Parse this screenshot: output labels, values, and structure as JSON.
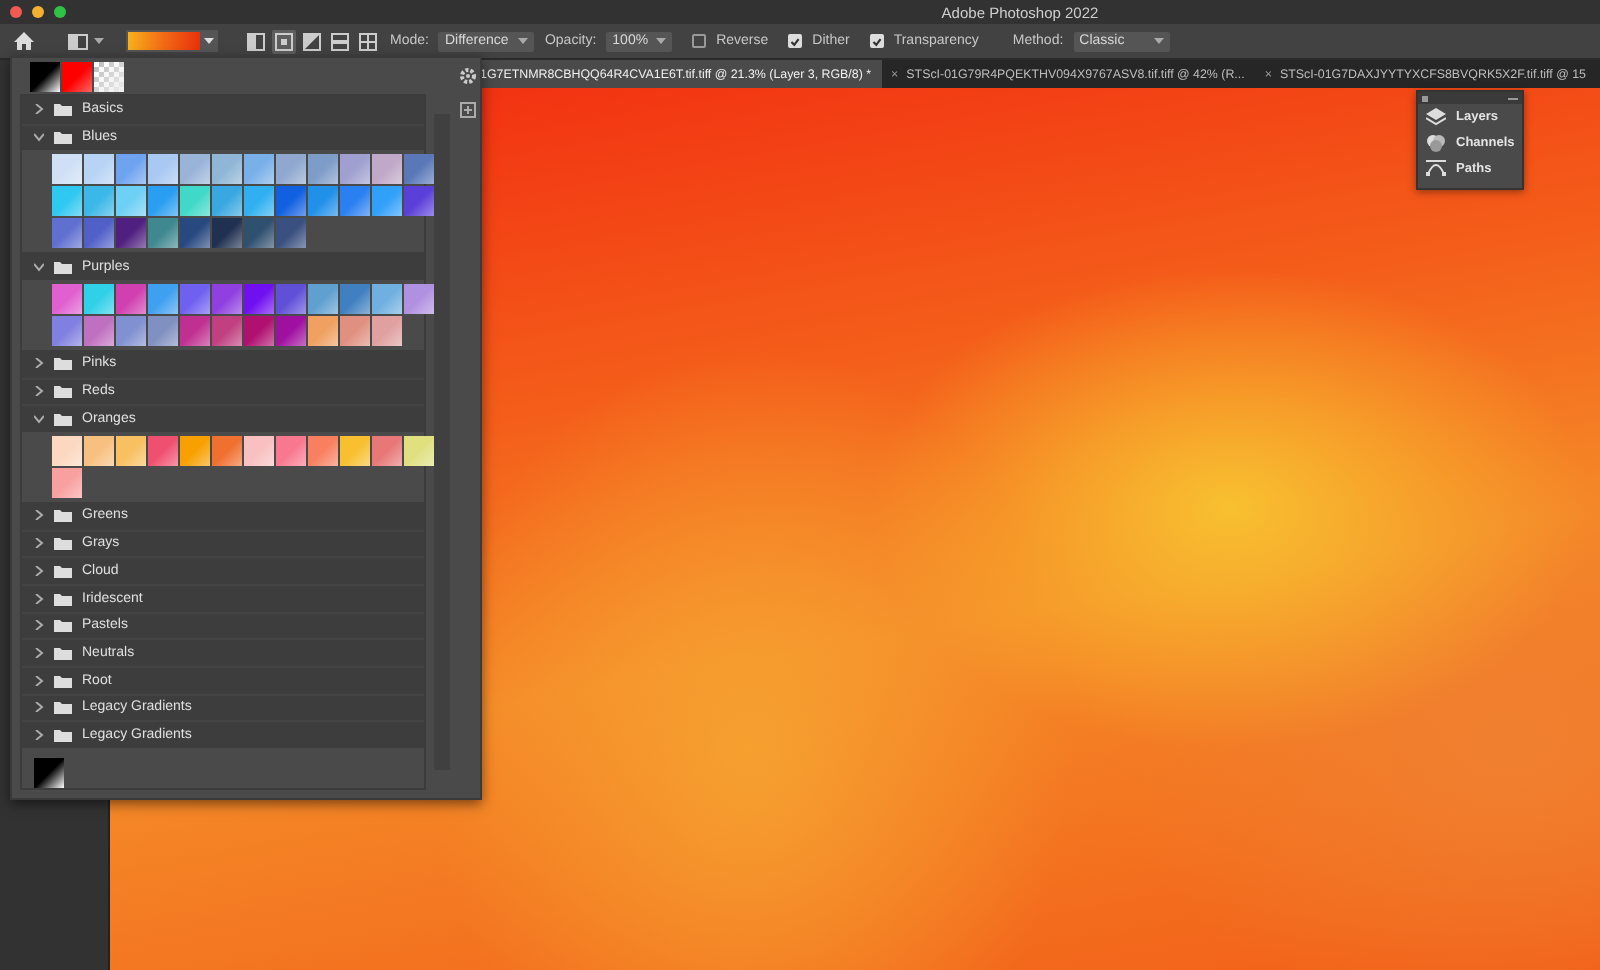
{
  "window": {
    "title": "Adobe Photoshop 2022"
  },
  "options_bar": {
    "gradient_types": [
      {
        "selected": false
      },
      {
        "selected": true
      },
      {
        "selected": false
      },
      {
        "selected": false
      },
      {
        "selected": false
      }
    ],
    "mode_label": "Mode:",
    "mode": "Difference",
    "opacity_label": "Opacity:",
    "opacity": "100%",
    "checkboxes": [
      {
        "label": "Reverse",
        "checked": false
      },
      {
        "label": "Dither",
        "checked": true
      },
      {
        "label": "Transparency",
        "checked": true
      }
    ],
    "method_label": "Method:",
    "method": "Classic"
  },
  "tabs": [
    {
      "label": "1G7ETNMR8CBHQQ64R4CVA1E6T.tif.tiff @ 21.3% (Layer 3, RGB/8) *",
      "selected": true
    },
    {
      "label": "STScI-01G79R4PQEKTHV094X9767ASV8.tif.tiff @ 42% (R...",
      "selected": false,
      "close": "×"
    },
    {
      "label": "STScI-01G7DAXJYYTYXCFS8BVQRK5X2F.tif.tiff @ 15",
      "selected": false,
      "close": "×"
    }
  ],
  "gradient_picker": {
    "recent": [
      {
        "color": "#000000"
      },
      {
        "color": "#ff0000"
      },
      {
        "color": "#c8c8c8"
      }
    ],
    "folders": [
      {
        "name": "Basics",
        "expanded": false
      },
      {
        "name": "Blues",
        "expanded": true,
        "swatches": [
          {
            "color": "#cfe0f5"
          },
          {
            "color": "#b8d4f5"
          },
          {
            "color": "#6fa3f0"
          },
          {
            "color": "#a9c8f2"
          },
          {
            "color": "#9ab4d8"
          },
          {
            "color": "#8fb6d6"
          },
          {
            "color": "#7ab0e8"
          },
          {
            "color": "#90a8d0"
          },
          {
            "color": "#7e9cc8"
          },
          {
            "color": "#a0a0d0"
          },
          {
            "color": "#c0a8c8"
          },
          {
            "color": "#5a78b8"
          },
          {
            "color": "#2fc8f0"
          },
          {
            "color": "#3bb8e8"
          },
          {
            "color": "#6fd0f5"
          },
          {
            "color": "#2a9ef0"
          },
          {
            "color": "#40d8c8"
          },
          {
            "color": "#3aa8e0"
          },
          {
            "color": "#30b0f0"
          },
          {
            "color": "#1060e0"
          },
          {
            "color": "#2090e8"
          },
          {
            "color": "#2a80f0"
          },
          {
            "color": "#30a0f8"
          },
          {
            "color": "#5a40d8"
          },
          {
            "color": "#6070d0"
          },
          {
            "color": "#5060c8"
          },
          {
            "color": "#502080"
          },
          {
            "color": "#408890"
          },
          {
            "color": "#284880"
          },
          {
            "color": "#203050"
          },
          {
            "color": "#305070"
          },
          {
            "color": "#3a5080"
          }
        ]
      },
      {
        "name": "Purples",
        "expanded": true,
        "swatches": [
          {
            "color": "#e060d0"
          },
          {
            "color": "#30d0e8"
          },
          {
            "color": "#d040b0"
          },
          {
            "color": "#40a0f0"
          },
          {
            "color": "#7060f0"
          },
          {
            "color": "#9040e0"
          },
          {
            "color": "#7010f0"
          },
          {
            "color": "#6050d8"
          },
          {
            "color": "#60a0d0"
          },
          {
            "color": "#4080c0"
          },
          {
            "color": "#70b0e0"
          },
          {
            "color": "#b090e0"
          },
          {
            "color": "#8080e0"
          },
          {
            "color": "#c070c0"
          },
          {
            "color": "#8090d0"
          },
          {
            "color": "#8090c0"
          },
          {
            "color": "#c03090"
          },
          {
            "color": "#c04080"
          },
          {
            "color": "#b01070"
          },
          {
            "color": "#a010a0"
          },
          {
            "color": "#f0a060"
          },
          {
            "color": "#e09080"
          },
          {
            "color": "#e0a0a0"
          }
        ]
      },
      {
        "name": "Pinks",
        "expanded": false
      },
      {
        "name": "Reds",
        "expanded": false
      },
      {
        "name": "Oranges",
        "expanded": true,
        "swatches": [
          {
            "color": "#fcd8c0"
          },
          {
            "color": "#f8c080"
          },
          {
            "color": "#f8c060"
          },
          {
            "color": "#f05070"
          },
          {
            "color": "#f8a000"
          },
          {
            "color": "#f07030"
          },
          {
            "color": "#f8c0c0"
          },
          {
            "color": "#f87890"
          },
          {
            "color": "#f88060"
          },
          {
            "color": "#f8c030"
          },
          {
            "color": "#e87878"
          },
          {
            "color": "#e0e080"
          },
          {
            "color": "#f8a0a0"
          }
        ]
      },
      {
        "name": "Greens",
        "expanded": false
      },
      {
        "name": "Grays",
        "expanded": false
      },
      {
        "name": "Cloud",
        "expanded": false
      },
      {
        "name": "Iridescent",
        "expanded": false
      },
      {
        "name": "Pastels",
        "expanded": false
      },
      {
        "name": "Neutrals",
        "expanded": false
      },
      {
        "name": "Root",
        "expanded": false
      },
      {
        "name": "Legacy Gradients",
        "expanded": false
      },
      {
        "name": "Legacy Gradients",
        "expanded": false
      }
    ],
    "loose": [
      {
        "color": "#000000"
      }
    ]
  },
  "panels": [
    {
      "kind": "layers",
      "label": "Layers"
    },
    {
      "kind": "channels",
      "label": "Channels"
    },
    {
      "kind": "paths",
      "label": "Paths"
    }
  ]
}
